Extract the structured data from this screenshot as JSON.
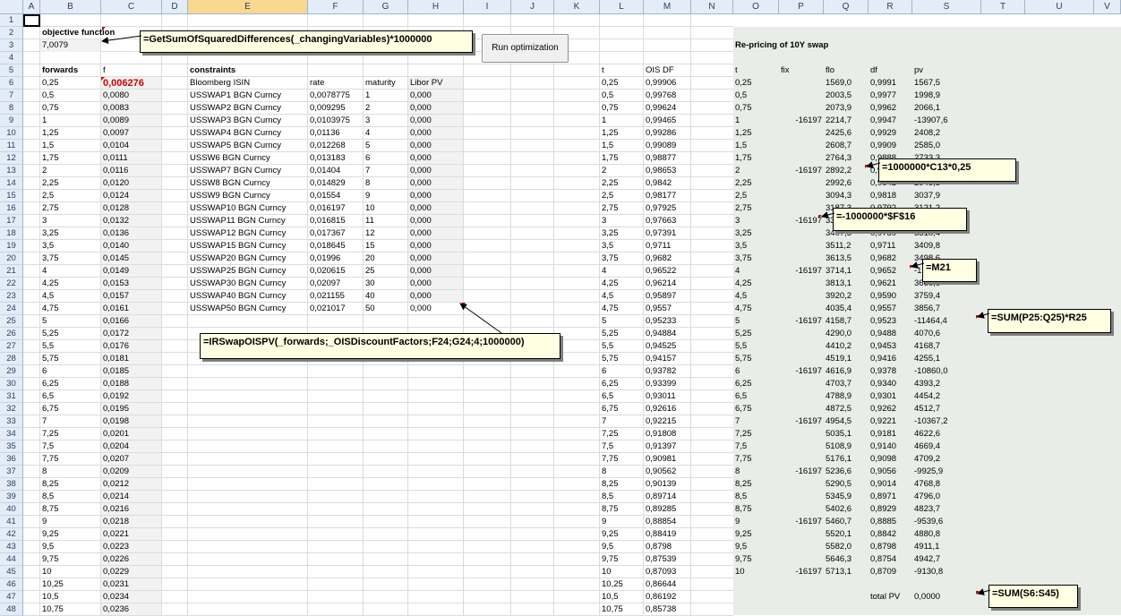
{
  "columns": [
    "A",
    "B",
    "C",
    "D",
    "E",
    "F",
    "G",
    "H",
    "I",
    "J",
    "K",
    "L",
    "M",
    "N",
    "O",
    "P",
    "Q",
    "R",
    "S",
    "T",
    "U",
    "V"
  ],
  "selected_column": "E",
  "objective": {
    "label": "objective function",
    "value": "7,0079"
  },
  "button": {
    "label": "Run optimization"
  },
  "forwards": {
    "header_t": "forwards",
    "header_f": "f",
    "t": [
      "0,25",
      "0,5",
      "0,75",
      "1",
      "1,25",
      "1,5",
      "1,75",
      "2",
      "2,25",
      "2,5",
      "2,75",
      "3",
      "3,25",
      "3,5",
      "3,75",
      "4",
      "4,25",
      "4,5",
      "4,75",
      "5",
      "5,25",
      "5,5",
      "5,75",
      "6",
      "6,25",
      "6,5",
      "6,75",
      "7",
      "7,25",
      "7,5",
      "7,75",
      "8",
      "8,25",
      "8,5",
      "8,75",
      "9",
      "9,25",
      "9,5",
      "9,75",
      "10",
      "10,25",
      "10,5",
      "10,75"
    ],
    "f": [
      "0,006276",
      "0,0080",
      "0,0083",
      "0,0089",
      "0,0097",
      "0,0104",
      "0,0111",
      "0,0116",
      "0,0120",
      "0,0124",
      "0,0128",
      "0,0132",
      "0,0136",
      "0,0140",
      "0,0145",
      "0,0149",
      "0,0153",
      "0,0157",
      "0,0161",
      "0,0166",
      "0,0172",
      "0,0176",
      "0,0181",
      "0,0185",
      "0,0188",
      "0,0192",
      "0,0195",
      "0,0198",
      "0,0201",
      "0,0204",
      "0,0207",
      "0,0209",
      "0,0212",
      "0,0214",
      "0,0216",
      "0,0218",
      "0,0221",
      "0,0223",
      "0,0226",
      "0,0229",
      "0,0231",
      "0,0234",
      "0,0236"
    ]
  },
  "constraints": {
    "title": "constraints",
    "headers": [
      "Bloomberg ISIN",
      "rate",
      "maturity",
      "Libor PV"
    ],
    "rows": [
      [
        "USSWAP1 BGN Curncy",
        "0,0078775",
        "1",
        "0,000"
      ],
      [
        "USSWAP2 BGN Curncy",
        "0,009295",
        "2",
        "0,000"
      ],
      [
        "USSWAP3 BGN Curncy",
        "0,0103975",
        "3",
        "0,000"
      ],
      [
        "USSWAP4 BGN Curncy",
        "0,01136",
        "4",
        "0,000"
      ],
      [
        "USSWAP5 BGN Curncy",
        "0,012268",
        "5",
        "0,000"
      ],
      [
        "USSW6 BGN Curncy",
        "0,013183",
        "6",
        "0,000"
      ],
      [
        "USSWAP7 BGN Curncy",
        "0,01404",
        "7",
        "0,000"
      ],
      [
        "USSW8 BGN Curncy",
        "0,014829",
        "8",
        "0,000"
      ],
      [
        "USSW9 BGN Curncy",
        "0,01554",
        "9",
        "0,000"
      ],
      [
        "USSWAP10 BGN Curncy",
        "0,016197",
        "10",
        "0,000"
      ],
      [
        "USSWAP11 BGN Curncy",
        "0,016815",
        "11",
        "0,000"
      ],
      [
        "USSWAP12 BGN Curncy",
        "0,017367",
        "12",
        "0,000"
      ],
      [
        "USSWAP15 BGN Curncy",
        "0,018645",
        "15",
        "0,000"
      ],
      [
        "USSWAP20 BGN Curncy",
        "0,01996",
        "20",
        "0,000"
      ],
      [
        "USSWAP25 BGN Curncy",
        "0,020615",
        "25",
        "0,000"
      ],
      [
        "USSWAP30 BGN Curncy",
        "0,02097",
        "30",
        "0,000"
      ],
      [
        "USSWAP40 BGN Curncy",
        "0,021155",
        "40",
        "0,000"
      ],
      [
        "USSWAP50 BGN Curncy",
        "0,021017",
        "50",
        "0,000"
      ]
    ]
  },
  "ois": {
    "headers": [
      "t",
      "OIS DF"
    ],
    "t": [
      "0,25",
      "0,5",
      "0,75",
      "1",
      "1,25",
      "1,5",
      "1,75",
      "2",
      "2,25",
      "2,5",
      "2,75",
      "3",
      "3,25",
      "3,5",
      "3,75",
      "4",
      "4,25",
      "4,5",
      "4,75",
      "5",
      "5,25",
      "5,5",
      "5,75",
      "6",
      "6,25",
      "6,5",
      "6,75",
      "7",
      "7,25",
      "7,5",
      "7,75",
      "8",
      "8,25",
      "8,5",
      "8,75",
      "9",
      "9,25",
      "9,5",
      "9,75",
      "10",
      "10,25",
      "10,5",
      "10,75"
    ],
    "df": [
      "0,99906",
      "0,99768",
      "0,99624",
      "0,99465",
      "0,99286",
      "0,99089",
      "0,98877",
      "0,98653",
      "0,9842",
      "0,98177",
      "0,97925",
      "0,97663",
      "0,97391",
      "0,9711",
      "0,9682",
      "0,96522",
      "0,96214",
      "0,95897",
      "0,9557",
      "0,95233",
      "0,94884",
      "0,94525",
      "0,94157",
      "0,93782",
      "0,93399",
      "0,93011",
      "0,92616",
      "0,92215",
      "0,91808",
      "0,91397",
      "0,90981",
      "0,90562",
      "0,90139",
      "0,89714",
      "0,89285",
      "0,88854",
      "0,88419",
      "0,8798",
      "0,87539",
      "0,87093",
      "0,86644",
      "0,86192",
      "0,85738"
    ]
  },
  "repricing": {
    "title": "Re-pricing of 10Y swap",
    "headers": [
      "t",
      "fix",
      "flo",
      "df",
      "pv"
    ],
    "rows": [
      [
        "0,25",
        "",
        "1569,0",
        "0,9991",
        "1567,5"
      ],
      [
        "0,5",
        "",
        "2003,5",
        "0,9977",
        "1998,9"
      ],
      [
        "0,75",
        "",
        "2073,9",
        "0,9962",
        "2066,1"
      ],
      [
        "1",
        "-16197",
        "2214,7",
        "0,9947",
        "-13907,6"
      ],
      [
        "1,25",
        "",
        "2425,6",
        "0,9929",
        "2408,2"
      ],
      [
        "1,5",
        "",
        "2608,7",
        "0,9909",
        "2585,0"
      ],
      [
        "1,75",
        "",
        "2764,3",
        "0,9888",
        "2733,3"
      ],
      [
        "2",
        "-16197",
        "2892,2",
        "0,9865",
        "-13314,1"
      ],
      [
        "2,25",
        "",
        "2992,6",
        "0,9842",
        "2945,3"
      ],
      [
        "2,5",
        "",
        "3094,3",
        "0,9818",
        "3037,9"
      ],
      [
        "2,75",
        "",
        "3187,3",
        "0,9792",
        "3121,2"
      ],
      [
        "3",
        "-16197",
        "3311,0",
        "0,9766",
        "-12584,5"
      ],
      [
        "3,25",
        "",
        "3407,3",
        "0,9739",
        "3318,4"
      ],
      [
        "3,5",
        "",
        "3511,2",
        "0,9711",
        "3409,8"
      ],
      [
        "3,75",
        "",
        "3613,5",
        "0,9682",
        "3498,6"
      ],
      [
        "4",
        "-16197",
        "3714,1",
        "0,9652",
        "-12048,4"
      ],
      [
        "4,25",
        "",
        "3813,1",
        "0,9621",
        "3668,8"
      ],
      [
        "4,5",
        "",
        "3920,2",
        "0,9590",
        "3759,4"
      ],
      [
        "4,75",
        "",
        "4035,4",
        "0,9557",
        "3856,7"
      ],
      [
        "5",
        "-16197",
        "4158,7",
        "0,9523",
        "-11464,4"
      ],
      [
        "5,25",
        "",
        "4290,0",
        "0,9488",
        "4070,6"
      ],
      [
        "5,5",
        "",
        "4410,2",
        "0,9453",
        "4168,7"
      ],
      [
        "5,75",
        "",
        "4519,1",
        "0,9416",
        "4255,1"
      ],
      [
        "6",
        "-16197",
        "4616,9",
        "0,9378",
        "-10860,0"
      ],
      [
        "6,25",
        "",
        "4703,7",
        "0,9340",
        "4393,2"
      ],
      [
        "6,5",
        "",
        "4788,9",
        "0,9301",
        "4454,2"
      ],
      [
        "6,75",
        "",
        "4872,5",
        "0,9262",
        "4512,7"
      ],
      [
        "7",
        "-16197",
        "4954,5",
        "0,9221",
        "-10367,2"
      ],
      [
        "7,25",
        "",
        "5035,1",
        "0,9181",
        "4622,6"
      ],
      [
        "7,5",
        "",
        "5108,9",
        "0,9140",
        "4669,4"
      ],
      [
        "7,75",
        "",
        "5176,1",
        "0,9098",
        "4709,2"
      ],
      [
        "8",
        "-16197",
        "5236,6",
        "0,9056",
        "-9925,9"
      ],
      [
        "8,25",
        "",
        "5290,5",
        "0,9014",
        "4768,8"
      ],
      [
        "8,5",
        "",
        "5345,9",
        "0,8971",
        "4796,0"
      ],
      [
        "8,75",
        "",
        "5402,6",
        "0,8929",
        "4823,7"
      ],
      [
        "9",
        "-16197",
        "5460,7",
        "0,8885",
        "-9539,6"
      ],
      [
        "9,25",
        "",
        "5520,1",
        "0,8842",
        "4880,8"
      ],
      [
        "9,5",
        "",
        "5582,0",
        "0,8798",
        "4911,1"
      ],
      [
        "9,75",
        "",
        "5646,3",
        "0,8754",
        "4942,7"
      ],
      [
        "10",
        "-16197",
        "5713,1",
        "0,8709",
        "-9130,8"
      ]
    ],
    "total_label": "total PV",
    "total_value": "0,0000"
  },
  "comments": {
    "objective": "=GetSumOfSquaredDifferences(_changingVariables)*1000000",
    "libor_pv": "=IRSwapOISPV(_forwards;_OISDiscountFactors;F24;G24;4;1000000)",
    "flo": "=1000000*C13*0,25",
    "fix": "=-1000000*$F$16",
    "df": "=M21",
    "pv_sum": "=SUM(P25:Q25)*R25",
    "total": "=SUM(S6:S45)"
  }
}
